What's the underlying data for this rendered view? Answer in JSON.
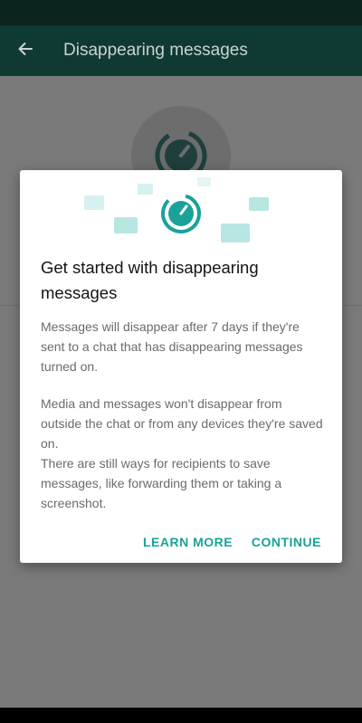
{
  "app_bar": {
    "title": "Disappearing messages"
  },
  "dialog": {
    "title": "Get started with disappearing messages",
    "paragraphs": [
      "Messages will disappear after 7 days if they're sent to a chat that has disappearing messages turned on.",
      "Media and messages won't disappear from outside the chat or from any devices they're saved on.",
      "There are still ways for recipients to save messages, like forwarding them or taking a screenshot."
    ],
    "actions": {
      "learn_more": "LEARN MORE",
      "continue": "CONTINUE"
    }
  },
  "colors": {
    "accent": "#1aa29a",
    "app_bar": "#0f3a33",
    "bubble": "#b8e6e3"
  },
  "icons": {
    "back": "arrow-left-icon",
    "timer": "timer-icon",
    "bubble": "chat-bubble-icon"
  }
}
